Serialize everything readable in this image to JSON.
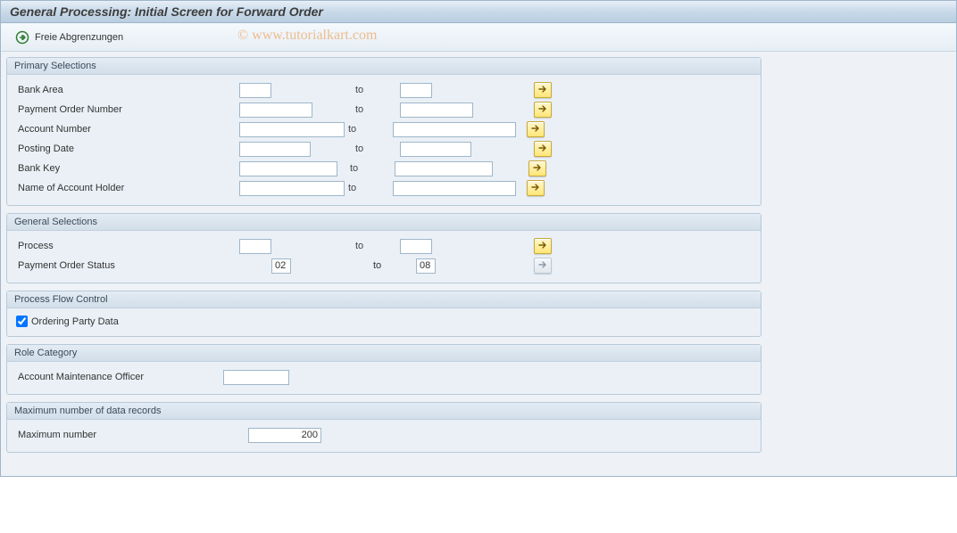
{
  "title": "General Processing: Initial Screen for Forward Order",
  "toolbar": {
    "free_delimitations": "Freie Abgrenzungen"
  },
  "watermark": "© www.tutorialkart.com",
  "to_label": "to",
  "groups": {
    "primary": {
      "title": "Primary Selections",
      "rows": {
        "bank_area": {
          "label": "Bank Area",
          "from": "",
          "to_val": ""
        },
        "payment_order_number": {
          "label": "Payment Order Number",
          "from": "",
          "to_val": ""
        },
        "account_number": {
          "label": "Account Number",
          "from": "",
          "to_val": ""
        },
        "posting_date": {
          "label": "Posting Date",
          "from": "",
          "to_val": ""
        },
        "bank_key": {
          "label": "Bank Key",
          "from": "",
          "to_val": ""
        },
        "name_holder": {
          "label": "Name of Account Holder",
          "from": "",
          "to_val": ""
        }
      }
    },
    "general": {
      "title": "General Selections",
      "rows": {
        "process": {
          "label": "Process",
          "from": "",
          "to_val": ""
        },
        "po_status": {
          "label": "Payment Order Status",
          "from": "02",
          "to_val": "08"
        }
      }
    },
    "flow": {
      "title": "Process Flow Control",
      "ordering_label": "Ordering Party Data",
      "ordering_checked": true
    },
    "role": {
      "title": "Role Category",
      "acct_officer_label": "Account Maintenance Officer",
      "acct_officer_value": ""
    },
    "max": {
      "title": "Maximum number of data records",
      "max_label": "Maximum number",
      "max_value": "200"
    }
  }
}
